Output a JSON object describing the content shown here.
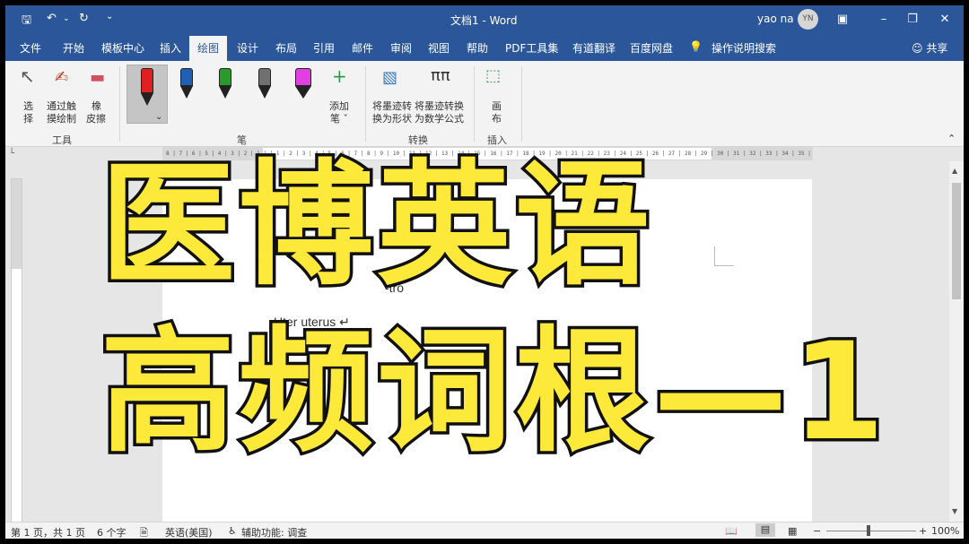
{
  "titlebar": {
    "title": "文档1 - Word",
    "user": "yao na",
    "avatar": "YN",
    "qa_icons": [
      "save-icon",
      "undo-icon",
      "redo-icon",
      "customize-icon"
    ]
  },
  "tabs": [
    "文件",
    "开始",
    "模板中心",
    "插入",
    "绘图",
    "设计",
    "布局",
    "引用",
    "邮件",
    "审阅",
    "视图",
    "帮助",
    "PDF工具集",
    "有道翻译",
    "百度网盘",
    "操作说明搜索"
  ],
  "active_tab": "绘图",
  "share": "共享",
  "ribbon": {
    "tools": {
      "select_line1": "选",
      "select_line2": "择",
      "touch_line1": "通过触",
      "touch_line2": "摸绘制",
      "eraser_line1": "橡",
      "eraser_line2": "皮擦",
      "group": "工具"
    },
    "pens": {
      "colors": [
        "#e02020",
        "#1f5fb5",
        "#2a9a2a",
        "#606060",
        "#e040e0"
      ],
      "add_line1": "添加",
      "add_line2": "笔 ˇ",
      "group": "笔"
    },
    "convert": {
      "shape_line1": "将墨迹转",
      "shape_line2": "换为形状",
      "math_line1": "将墨迹转换",
      "math_line2": "为数学公式",
      "group": "转换"
    },
    "insert": {
      "canvas_line1": "画",
      "canvas_line2": "布",
      "group": "插入"
    }
  },
  "ruler_text": "8 | 7 | 6 | 5 | 4 | 3 | 2 | 1 |   | 1 | 2 | 3 | 4 | 5 | 6 | 7 | 8 | 9 | 10 | 11 | 12 | 13 | 14 | 15 | 16 | 17 | 18 | 19 | 20 | 21 | 22 | 23 | 24 | 25 | 26 | 27 | 28 | 29 | 30 | 31 | 32 | 33 | 34 | 35 | 36 | 37 | 38 | 39 | 40 | 41 | 42 | 43 | 44 | 45 | 46 | 47 | 48",
  "document": {
    "line1_visible": "-tro",
    "line2": "Uter uterus ↵"
  },
  "overlay": {
    "line1": "医博英语",
    "line2": "高频词根—1"
  },
  "statusbar": {
    "page": "第 1 页，共 1 页",
    "words": "6 个字",
    "language": "英语(美国)",
    "accessibility": "辅助功能: 调查",
    "zoom": "100%"
  }
}
